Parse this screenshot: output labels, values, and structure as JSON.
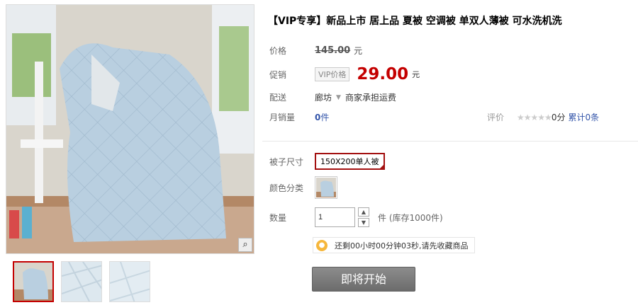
{
  "product": {
    "title": "【VIP专享】新品上市 居上品 夏被 空调被 单双人薄被 可水洗机洗"
  },
  "price": {
    "label": "价格",
    "original": "145.00",
    "unit": "元"
  },
  "promo": {
    "label": "促销",
    "tag": "VIP价格",
    "price": "29.00",
    "unit": "元"
  },
  "delivery": {
    "label": "配送",
    "location": "廊坊",
    "shipping": "商家承担运费"
  },
  "sales": {
    "label": "月销量",
    "count": "0",
    "unit": "件"
  },
  "rating": {
    "label": "评价",
    "stars": "★★★★★",
    "score": "0分",
    "cumulative": "累计0条"
  },
  "options": {
    "size_label": "被子尺寸",
    "size_value": "150X200单人被",
    "color_label": "颜色分类"
  },
  "quantity": {
    "label": "数量",
    "value": "1",
    "stock": "件 (库存1000件)"
  },
  "notice": {
    "text": "还剩00小时00分钟03秒,请先收藏商品"
  },
  "buy_button": {
    "label": "即将开始"
  },
  "icons": {
    "zoom": "magnifier-icon",
    "tip": "lightbulb-icon",
    "up": "chevron-up-icon",
    "down": "chevron-down-icon"
  },
  "colors": {
    "accent": "#c40000",
    "link": "#3355aa",
    "button": "#7a7a7a"
  }
}
